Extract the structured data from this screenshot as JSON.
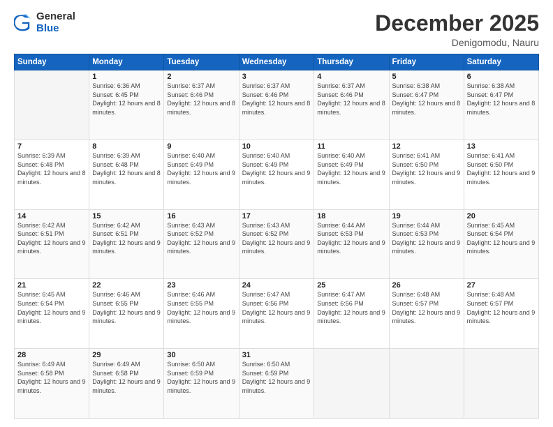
{
  "logo": {
    "general": "General",
    "blue": "Blue"
  },
  "header": {
    "month": "December 2025",
    "location": "Denigomodu, Nauru"
  },
  "weekdays": [
    "Sunday",
    "Monday",
    "Tuesday",
    "Wednesday",
    "Thursday",
    "Friday",
    "Saturday"
  ],
  "weeks": [
    [
      {
        "day": "",
        "sunrise": "",
        "sunset": "",
        "daylight": ""
      },
      {
        "day": "1",
        "sunrise": "Sunrise: 6:36 AM",
        "sunset": "Sunset: 6:45 PM",
        "daylight": "Daylight: 12 hours and 8 minutes."
      },
      {
        "day": "2",
        "sunrise": "Sunrise: 6:37 AM",
        "sunset": "Sunset: 6:46 PM",
        "daylight": "Daylight: 12 hours and 8 minutes."
      },
      {
        "day": "3",
        "sunrise": "Sunrise: 6:37 AM",
        "sunset": "Sunset: 6:46 PM",
        "daylight": "Daylight: 12 hours and 8 minutes."
      },
      {
        "day": "4",
        "sunrise": "Sunrise: 6:37 AM",
        "sunset": "Sunset: 6:46 PM",
        "daylight": "Daylight: 12 hours and 8 minutes."
      },
      {
        "day": "5",
        "sunrise": "Sunrise: 6:38 AM",
        "sunset": "Sunset: 6:47 PM",
        "daylight": "Daylight: 12 hours and 8 minutes."
      },
      {
        "day": "6",
        "sunrise": "Sunrise: 6:38 AM",
        "sunset": "Sunset: 6:47 PM",
        "daylight": "Daylight: 12 hours and 8 minutes."
      }
    ],
    [
      {
        "day": "7",
        "sunrise": "Sunrise: 6:39 AM",
        "sunset": "Sunset: 6:48 PM",
        "daylight": "Daylight: 12 hours and 8 minutes."
      },
      {
        "day": "8",
        "sunrise": "Sunrise: 6:39 AM",
        "sunset": "Sunset: 6:48 PM",
        "daylight": "Daylight: 12 hours and 8 minutes."
      },
      {
        "day": "9",
        "sunrise": "Sunrise: 6:40 AM",
        "sunset": "Sunset: 6:49 PM",
        "daylight": "Daylight: 12 hours and 9 minutes."
      },
      {
        "day": "10",
        "sunrise": "Sunrise: 6:40 AM",
        "sunset": "Sunset: 6:49 PM",
        "daylight": "Daylight: 12 hours and 9 minutes."
      },
      {
        "day": "11",
        "sunrise": "Sunrise: 6:40 AM",
        "sunset": "Sunset: 6:49 PM",
        "daylight": "Daylight: 12 hours and 9 minutes."
      },
      {
        "day": "12",
        "sunrise": "Sunrise: 6:41 AM",
        "sunset": "Sunset: 6:50 PM",
        "daylight": "Daylight: 12 hours and 9 minutes."
      },
      {
        "day": "13",
        "sunrise": "Sunrise: 6:41 AM",
        "sunset": "Sunset: 6:50 PM",
        "daylight": "Daylight: 12 hours and 9 minutes."
      }
    ],
    [
      {
        "day": "14",
        "sunrise": "Sunrise: 6:42 AM",
        "sunset": "Sunset: 6:51 PM",
        "daylight": "Daylight: 12 hours and 9 minutes."
      },
      {
        "day": "15",
        "sunrise": "Sunrise: 6:42 AM",
        "sunset": "Sunset: 6:51 PM",
        "daylight": "Daylight: 12 hours and 9 minutes."
      },
      {
        "day": "16",
        "sunrise": "Sunrise: 6:43 AM",
        "sunset": "Sunset: 6:52 PM",
        "daylight": "Daylight: 12 hours and 9 minutes."
      },
      {
        "day": "17",
        "sunrise": "Sunrise: 6:43 AM",
        "sunset": "Sunset: 6:52 PM",
        "daylight": "Daylight: 12 hours and 9 minutes."
      },
      {
        "day": "18",
        "sunrise": "Sunrise: 6:44 AM",
        "sunset": "Sunset: 6:53 PM",
        "daylight": "Daylight: 12 hours and 9 minutes."
      },
      {
        "day": "19",
        "sunrise": "Sunrise: 6:44 AM",
        "sunset": "Sunset: 6:53 PM",
        "daylight": "Daylight: 12 hours and 9 minutes."
      },
      {
        "day": "20",
        "sunrise": "Sunrise: 6:45 AM",
        "sunset": "Sunset: 6:54 PM",
        "daylight": "Daylight: 12 hours and 9 minutes."
      }
    ],
    [
      {
        "day": "21",
        "sunrise": "Sunrise: 6:45 AM",
        "sunset": "Sunset: 6:54 PM",
        "daylight": "Daylight: 12 hours and 9 minutes."
      },
      {
        "day": "22",
        "sunrise": "Sunrise: 6:46 AM",
        "sunset": "Sunset: 6:55 PM",
        "daylight": "Daylight: 12 hours and 9 minutes."
      },
      {
        "day": "23",
        "sunrise": "Sunrise: 6:46 AM",
        "sunset": "Sunset: 6:55 PM",
        "daylight": "Daylight: 12 hours and 9 minutes."
      },
      {
        "day": "24",
        "sunrise": "Sunrise: 6:47 AM",
        "sunset": "Sunset: 6:56 PM",
        "daylight": "Daylight: 12 hours and 9 minutes."
      },
      {
        "day": "25",
        "sunrise": "Sunrise: 6:47 AM",
        "sunset": "Sunset: 6:56 PM",
        "daylight": "Daylight: 12 hours and 9 minutes."
      },
      {
        "day": "26",
        "sunrise": "Sunrise: 6:48 AM",
        "sunset": "Sunset: 6:57 PM",
        "daylight": "Daylight: 12 hours and 9 minutes."
      },
      {
        "day": "27",
        "sunrise": "Sunrise: 6:48 AM",
        "sunset": "Sunset: 6:57 PM",
        "daylight": "Daylight: 12 hours and 9 minutes."
      }
    ],
    [
      {
        "day": "28",
        "sunrise": "Sunrise: 6:49 AM",
        "sunset": "Sunset: 6:58 PM",
        "daylight": "Daylight: 12 hours and 9 minutes."
      },
      {
        "day": "29",
        "sunrise": "Sunrise: 6:49 AM",
        "sunset": "Sunset: 6:58 PM",
        "daylight": "Daylight: 12 hours and 9 minutes."
      },
      {
        "day": "30",
        "sunrise": "Sunrise: 6:50 AM",
        "sunset": "Sunset: 6:59 PM",
        "daylight": "Daylight: 12 hours and 9 minutes."
      },
      {
        "day": "31",
        "sunrise": "Sunrise: 6:50 AM",
        "sunset": "Sunset: 6:59 PM",
        "daylight": "Daylight: 12 hours and 9 minutes."
      },
      {
        "day": "",
        "sunrise": "",
        "sunset": "",
        "daylight": ""
      },
      {
        "day": "",
        "sunrise": "",
        "sunset": "",
        "daylight": ""
      },
      {
        "day": "",
        "sunrise": "",
        "sunset": "",
        "daylight": ""
      }
    ]
  ]
}
